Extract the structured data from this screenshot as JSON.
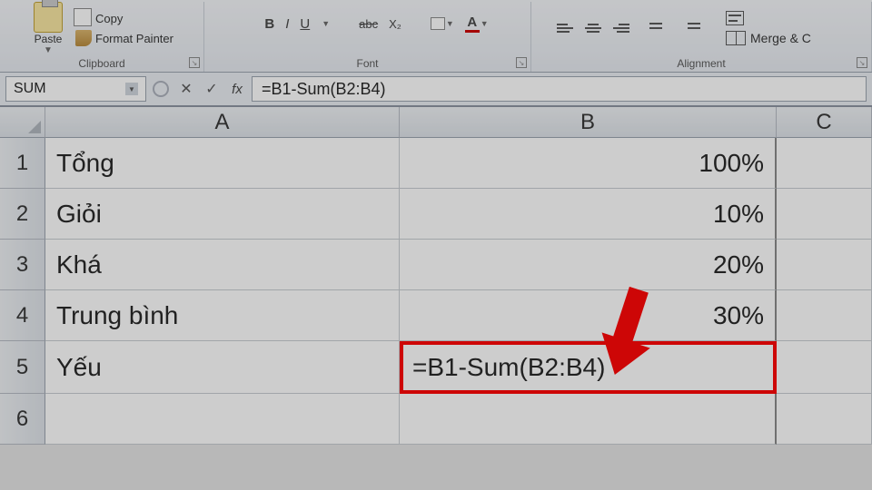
{
  "ribbon": {
    "clipboard": {
      "label": "Clipboard",
      "paste": "Paste",
      "copy": "Copy",
      "format_painter": "Format Painter"
    },
    "font": {
      "label": "Font",
      "bold": "B",
      "italic": "I",
      "underline": "U",
      "strike": "abc",
      "sub": "X₂",
      "color_letter": "A"
    },
    "alignment": {
      "label": "Alignment",
      "wrap": "Wrap Text",
      "merge": "Merge & C"
    }
  },
  "formula_bar": {
    "name_box": "SUM",
    "fx": "fx",
    "formula": "=B1-Sum(B2:B4)"
  },
  "columns": {
    "A": "A",
    "B": "B",
    "C": "C"
  },
  "rows": {
    "1": {
      "num": "1",
      "A": "Tổng",
      "B": "100%"
    },
    "2": {
      "num": "2",
      "A": "Giỏi",
      "B": "10%"
    },
    "3": {
      "num": "3",
      "A": "Khá",
      "B": "20%"
    },
    "4": {
      "num": "4",
      "A": "Trung bình",
      "B": "30%"
    },
    "5": {
      "num": "5",
      "A": "Yếu",
      "B": "=B1-Sum(B2:B4)"
    },
    "6": {
      "num": "6",
      "A": "",
      "B": ""
    }
  }
}
